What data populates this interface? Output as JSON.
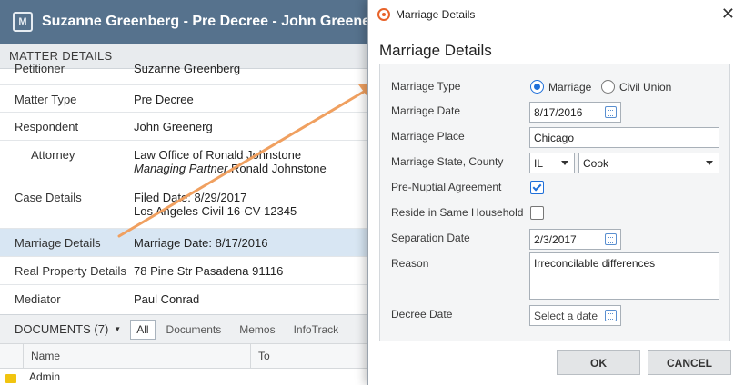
{
  "app": {
    "title": "Suzanne Greenberg - Pre Decree - John Greenerg | Lo",
    "icon_letter": "M"
  },
  "matter_details": {
    "header": "MATTER DETAILS",
    "rows": [
      {
        "label": "Petitioner",
        "value": "Suzanne Greenberg"
      },
      {
        "label": "Matter Type",
        "value": "Pre Decree"
      },
      {
        "label": "Respondent",
        "value": "John Greenerg"
      },
      {
        "label": "Attorney",
        "value": "Law Office of Ronald Johnstone",
        "value2_italic": "Managing Partner",
        "value2": " Ronald Johnstone"
      },
      {
        "label": "Case Details",
        "value": "Filed Date: 8/29/2017",
        "value2": "Los Angeles Civil 16-CV-12345"
      },
      {
        "label": "Marriage Details",
        "value": "Marriage Date: 8/17/2016"
      },
      {
        "label": "Real Property Details",
        "value": "78 Pine Str Pasadena 91116"
      },
      {
        "label": "Mediator",
        "value": "Paul Conrad"
      }
    ]
  },
  "documents": {
    "title": "DOCUMENTS (7)",
    "tabs": [
      "All",
      "Documents",
      "Memos",
      "InfoTrack"
    ],
    "columns": [
      "Name",
      "To"
    ],
    "first_row": "Admin"
  },
  "dialog": {
    "window_title": "Marriage Details",
    "heading": "Marriage Details",
    "fields": {
      "marriage_type_label": "Marriage Type",
      "marriage_type_options": [
        "Marriage",
        "Civil Union"
      ],
      "marriage_type_selected": "Marriage",
      "marriage_date_label": "Marriage Date",
      "marriage_date": "8/17/2016",
      "marriage_place_label": "Marriage Place",
      "marriage_place": "Chicago",
      "state_county_label": "Marriage State, County",
      "state": "IL",
      "county": "Cook",
      "prenup_label": "Pre-Nuptial Agreement",
      "prenup_checked": true,
      "same_household_label": "Reside in Same Household",
      "same_household_checked": false,
      "separation_date_label": "Separation Date",
      "separation_date": "2/3/2017",
      "reason_label": "Reason",
      "reason": "Irreconcilable differences",
      "decree_date_label": "Decree Date",
      "decree_date_placeholder": "Select a date"
    },
    "buttons": {
      "ok": "OK",
      "cancel": "CANCEL"
    }
  },
  "colors": {
    "header_bg": "#56728d",
    "selected_row": "#d8e6f3",
    "accent": "#1e6fd9",
    "arrow": "#f0a060"
  }
}
